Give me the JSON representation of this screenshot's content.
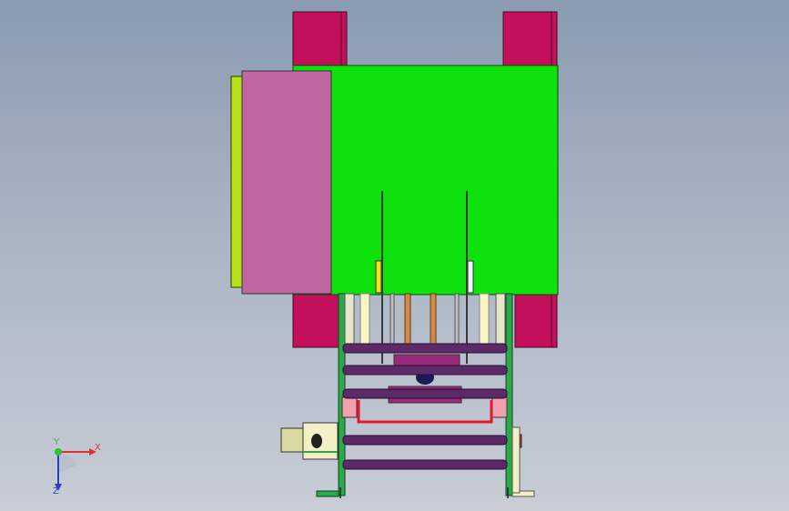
{
  "viewport": {
    "triad": {
      "x_label": "X",
      "y_label": "Y",
      "z_label": "Z",
      "colors": {
        "x": "#e0322c",
        "y": "#2fbf3a",
        "z": "#2a3fc6"
      }
    },
    "colors": {
      "background_top": "#8a9bb0",
      "background_bottom": "#c8cdd6",
      "frame_green": "#0de20d",
      "cover_pink": "#c066a0",
      "side_plate": "#b7e01a",
      "post_crimson": "#c2105a",
      "roller_purple": "#5c2a66",
      "rail_green": "#2aa84a",
      "light_pink": "#f2a0b0",
      "cream": "#f3efc7"
    }
  }
}
